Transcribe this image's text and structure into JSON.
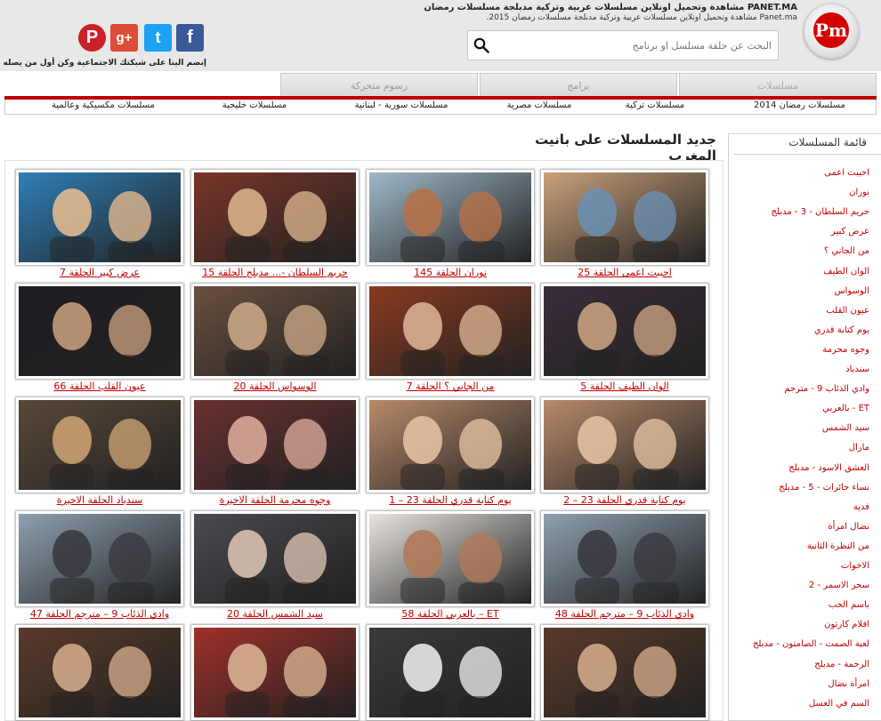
{
  "header": {
    "site_title": "PANET.MA مشاهدة وتحميل اونلاين مسلسلات عربية وتركية مدبلجة مسلسلات رمضان 2015",
    "site_subtitle": "Panet.ma مشاهدة وتحميل اونلاين مسلسلات عربية وتركية مدبلجة مسلسلات رمضان 2015.",
    "logo_text": "Pm",
    "search_placeholder": "البحث عن حلقة مسلسل او برنامج",
    "join_text": "إنضم الينا على شبكتك الاجتماعية وكن أول من يصله الجديد",
    "social": [
      {
        "name": "facebook-icon",
        "glyph": "f",
        "color": "#3b5998"
      },
      {
        "name": "twitter-icon",
        "glyph": "t",
        "color": "#1da1f2"
      },
      {
        "name": "google-plus-icon",
        "glyph": "g+",
        "color": "#dd4b39"
      },
      {
        "name": "pinterest-icon",
        "glyph": "P",
        "color": "#cb2027"
      }
    ]
  },
  "tabs": [
    {
      "label": "مسلسلات"
    },
    {
      "label": "برامج"
    },
    {
      "label": "رسوم متحركة"
    }
  ],
  "subnav": [
    {
      "label": "مسلسلات رمضان 2014"
    },
    {
      "label": "مسلسلات تركية"
    },
    {
      "label": "مسلسلات مصرية"
    },
    {
      "label": "مسلسلات سورية - لبنانية"
    },
    {
      "label": "مسلسلات خليجية"
    },
    {
      "label": "مسلسلات مكسيكية وعالمية"
    }
  ],
  "sidebar": {
    "title": "قائمة المسلسلات",
    "items": [
      "احببت اعمى",
      "نوران",
      "حريم السلطان - 3 - مدبلج",
      "عرض كبير",
      "من الجاني ؟",
      "الوان الطيف",
      "الوسواس",
      "عيون القلب",
      "يوم كتابة قدري",
      "وجوه محرمة",
      "سندباد",
      "وادي الذئاب 9 - مترجم",
      "ET - بالعربي",
      "سيد الشمس",
      "مارال",
      "العشق الاسود - مدبلج",
      "نساء حائرات - 5 - مدبلج",
      "فدية",
      "نضال امرأة",
      "من النظرة الثانية",
      "الاخوات",
      "سحر الاسمر - 2",
      "باسم الحب",
      "افلام كارتون",
      "لعبة الصمت - الصامتون - مدبلج",
      "الرحمة - مدبلج",
      "امرأة نضال",
      "السم في العسل"
    ]
  },
  "main": {
    "section_title": "جديد المسلسلات على بانيت المغرب",
    "cards": [
      {
        "label": "احببت اعمى الحلقة 25",
        "bg": "#c9a07a",
        "accent": "#6b8fb0"
      },
      {
        "label": "نوران الحلقة 145",
        "bg": "#9fb8c8",
        "accent": "#b5724a"
      },
      {
        "label": "حريم السلطان -... مدبلج الحلقة 15",
        "bg": "#7a3528",
        "accent": "#d7b08a"
      },
      {
        "label": "عرض كبير الحلقة 7",
        "bg": "#2e7fb8",
        "accent": "#e0b98f"
      },
      {
        "label": "الوان الطيف الحلقة 5",
        "bg": "#3a2d3a",
        "accent": "#c8a080"
      },
      {
        "label": "من الجاني ؟ الحلقة 7",
        "bg": "#8a3a20",
        "accent": "#d8b090"
      },
      {
        "label": "الوسواس الحلقة 20",
        "bg": "#6b5040",
        "accent": "#c9a585"
      },
      {
        "label": "عيون القلب الحلقة 66",
        "bg": "#1f1c22",
        "accent": "#c49a7a"
      },
      {
        "label": "يوم كتابة قدري الحلقة 23 – 2",
        "bg": "#b88a6a",
        "accent": "#e2c0a0"
      },
      {
        "label": "يوم كتابة قدري الحلقة 23 – 1",
        "bg": "#b88a6a",
        "accent": "#e2c0a0"
      },
      {
        "label": "وجوه محرمة الحلقة الاخيرة",
        "bg": "#6a3030",
        "accent": "#d8a898"
      },
      {
        "label": "سندباد الحلقة الاخيرة",
        "bg": "#5a4838",
        "accent": "#c8a070"
      },
      {
        "label": "وادي الذئاب 9 – مترجم الحلقة 48",
        "bg": "#8fa0b0",
        "accent": "#3a3a40"
      },
      {
        "label": "ET – بالعربي الحلقة 58",
        "bg": "#e8e4e0",
        "accent": "#b07a5a"
      },
      {
        "label": "سيد الشمس الحلقة 20",
        "bg": "#4a4a50",
        "accent": "#d8c0b0"
      },
      {
        "label": "وادي الذئاب 9 – مترجم الحلقة 47",
        "bg": "#8fa0b0",
        "accent": "#3a3a40"
      },
      {
        "label": "",
        "bg": "#5a3a2a",
        "accent": "#d0a888"
      },
      {
        "label": "",
        "bg": "#3a3a3a",
        "accent": "#e8e8e8"
      },
      {
        "label": "",
        "bg": "#a0302a",
        "accent": "#d8b090"
      },
      {
        "label": "",
        "bg": "#5a3a2a",
        "accent": "#d0a888"
      }
    ]
  }
}
